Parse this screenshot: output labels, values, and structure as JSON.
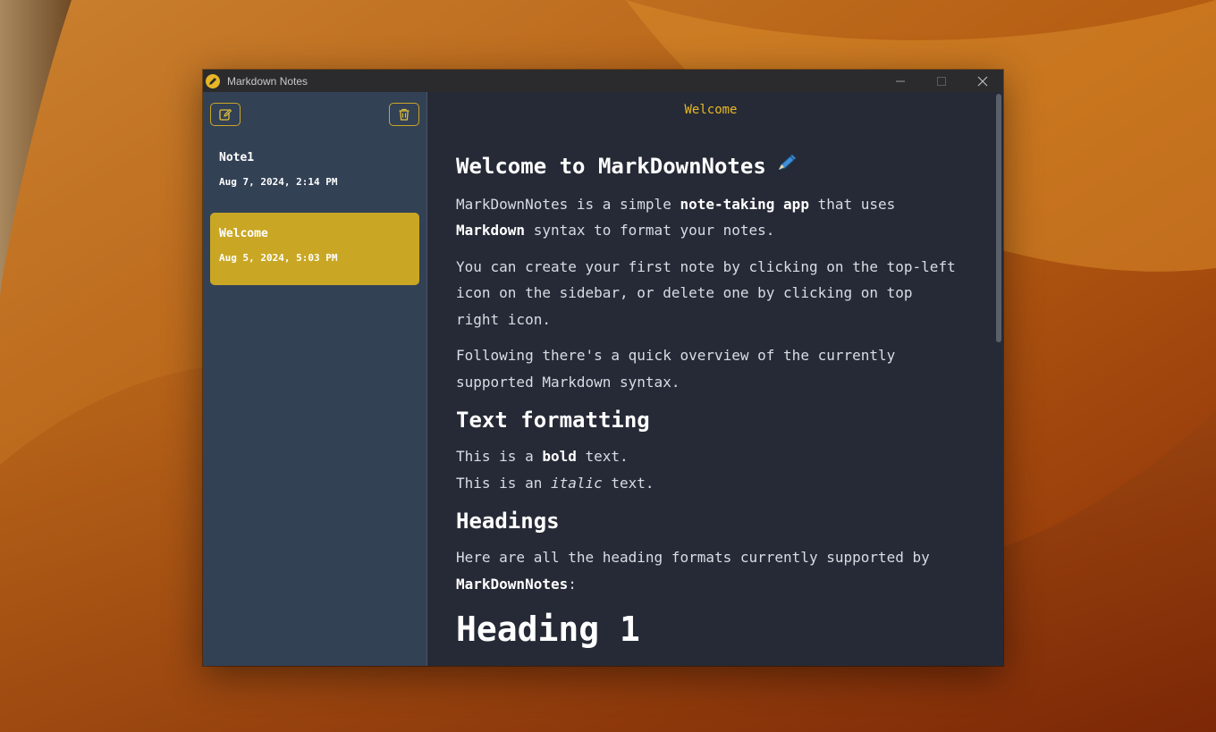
{
  "window": {
    "title": "Markdown Notes"
  },
  "sidebar": {
    "new_note_icon": "pencil-square-icon",
    "delete_note_icon": "trash-icon",
    "notes": [
      {
        "title": "Note1",
        "date": "Aug 7, 2024, 2:14 PM",
        "selected": false
      },
      {
        "title": "Welcome",
        "date": "Aug 5, 2024, 5:03 PM",
        "selected": true
      }
    ]
  },
  "main": {
    "title": "Welcome",
    "content": {
      "h1": "Welcome to MarkDownNotes",
      "p1_pre": "MarkDownNotes is a simple ",
      "p1_bold1": "note-taking app",
      "p1_mid": " that uses ",
      "p1_bold2": "Markdown",
      "p1_post": " syntax to format your notes.",
      "p2": "You can create your first note by clicking on the top-left icon on the sidebar, or delete one by clicking on top right icon.",
      "p3": "Following there's a quick overview of the currently supported Markdown syntax.",
      "h2_text_formatting": "Text formatting",
      "bold_line_pre": "This is a ",
      "bold_word": "bold",
      "bold_line_post": " text.",
      "italic_line_pre": "This is an ",
      "italic_word": "italic",
      "italic_line_post": " text.",
      "h2_headings": "Headings",
      "p4_pre": "Here are all the heading formats currently supported by ",
      "p4_bold": "MarkDownNotes",
      "p4_post": ":",
      "heading1_sample": "Heading 1"
    }
  },
  "colors": {
    "accent": "#c9a724",
    "sidebar_bg": "#334155",
    "main_bg": "#262a36",
    "title_accent": "#e8b825"
  }
}
